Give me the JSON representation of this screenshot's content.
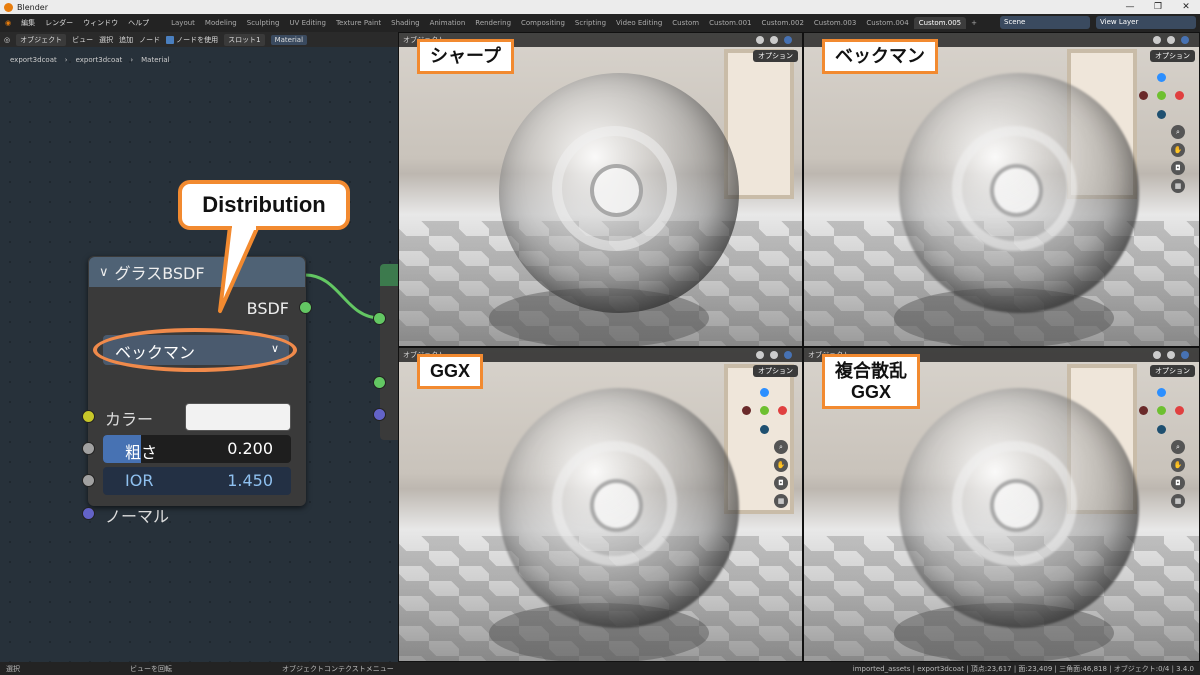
{
  "window": {
    "title": "Blender",
    "controls": [
      "—",
      "❐",
      "✕"
    ]
  },
  "menubar": {
    "menus": [
      "編集",
      "レンダー",
      "ウィンドウ",
      "ヘルプ"
    ],
    "workspaces": [
      "Layout",
      "Modeling",
      "Sculpting",
      "UV Editing",
      "Texture Paint",
      "Shading",
      "Animation",
      "Rendering",
      "Compositing",
      "Scripting",
      "Video Editing",
      "Custom",
      "Custom.001",
      "Custom.002",
      "Custom.003",
      "Custom.004",
      "Custom.005"
    ],
    "active_workspace": "Custom.005",
    "scene": "Scene",
    "view_layer": "View Layer"
  },
  "node_editor": {
    "header": {
      "mode": "オブジェクト",
      "view": "ビュー",
      "select": "選択",
      "add": "追加",
      "node": "ノード",
      "use_nodes": "ノードを使用",
      "slot": "スロット1",
      "material": "Material"
    },
    "breadcrumb": [
      "export3dcoat",
      "export3dcoat",
      "Material"
    ],
    "callout": "Distribution",
    "node": {
      "title": "グラスBSDF",
      "output": "BSDF",
      "distribution": "ベックマン",
      "color_label": "カラー",
      "color_value": "#f2f2f2",
      "roughness_label": "粗さ",
      "roughness_value": "0.200",
      "roughness_fraction": 0.2,
      "ior_label": "IOR",
      "ior_value": "1.450",
      "normal_label": "ノーマル"
    },
    "socket_colors": {
      "shader": "#63c763",
      "color": "#c7c729",
      "float": "#a1a1a1",
      "vector": "#6363c7"
    }
  },
  "viewports": [
    {
      "label": "シャープ",
      "options": "オプション"
    },
    {
      "label": "ベックマン",
      "options": "オプション"
    },
    {
      "label": "GGX",
      "options": "オプション"
    },
    {
      "label": "複合散乱\nGGX",
      "options": "オプション"
    }
  ],
  "viewport_header_text": "オブジェクト",
  "statusbar": {
    "select": "選択",
    "rotate": "ビューを回転",
    "context_menu": "オブジェクトコンテクストメニュー",
    "info": "imported_assets | export3dcoat | 頂点:23,617 | 面:23,409 | 三角面:46,818 | オブジェクト:0/4 | 3.4.0"
  },
  "accent": "#f28a30"
}
